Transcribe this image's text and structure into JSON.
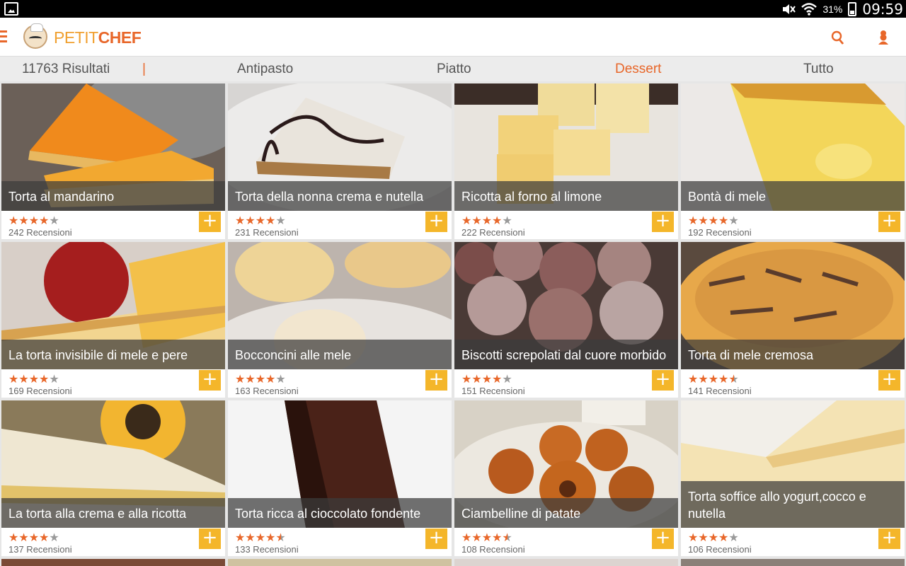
{
  "status_bar": {
    "battery": "31%",
    "time": "09:59"
  },
  "app": {
    "logo_petit": "PETIT",
    "logo_chef": "CHEF"
  },
  "filters": {
    "results": "11763 Risultati",
    "separator": "|",
    "antipasto": "Antipasto",
    "piatto": "Piatto",
    "dessert": "Dessert",
    "tutto": "Tutto",
    "active": "Dessert"
  },
  "colors": {
    "accent": "#e8672a",
    "add_button": "#f4b62a"
  },
  "recipes": [
    {
      "title": "Torta al mandarino",
      "stars": 4,
      "reviews": "242 Recensioni"
    },
    {
      "title": "Torta della nonna crema e nutella",
      "stars": 4,
      "reviews": "231 Recensioni"
    },
    {
      "title": "Ricotta al forno al limone",
      "stars": 4,
      "reviews": "222 Recensioni"
    },
    {
      "title": "Bontà di mele",
      "stars": 4,
      "reviews": "192 Recensioni"
    },
    {
      "title": "La torta invisibile di mele e pere",
      "stars": 4,
      "reviews": "169 Recensioni"
    },
    {
      "title": "Bocconcini alle mele",
      "stars": 4,
      "reviews": "163 Recensioni"
    },
    {
      "title": "Biscotti screpolati dal cuore morbido",
      "stars": 4,
      "reviews": "151 Recensioni"
    },
    {
      "title": "Torta di mele cremosa",
      "stars": 4.5,
      "reviews": "141 Recensioni"
    },
    {
      "title": "La torta alla crema e alla ricotta",
      "stars": 4,
      "reviews": "137 Recensioni"
    },
    {
      "title": "Torta ricca al cioccolato fondente",
      "stars": 4.5,
      "reviews": "133 Recensioni"
    },
    {
      "title": "Ciambelline di patate",
      "stars": 4.5,
      "reviews": "108 Recensioni"
    },
    {
      "title": "Torta soffice allo yogurt,cocco e nutella",
      "stars": 4,
      "reviews": "106 Recensioni"
    }
  ],
  "add_label": "+"
}
